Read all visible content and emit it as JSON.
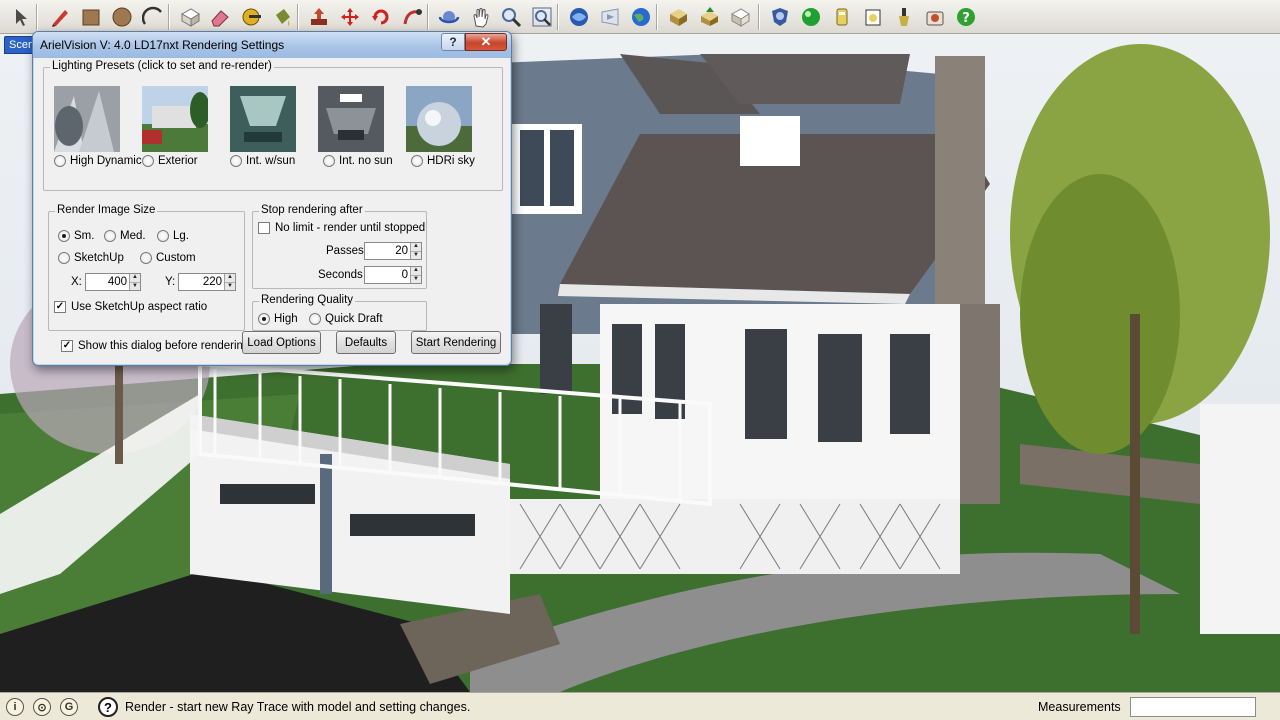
{
  "toolbar": {
    "tools": [
      {
        "name": "select-icon",
        "color": "#4a4a4a"
      },
      {
        "name": "pencil-icon",
        "color": "#c83a2a"
      },
      {
        "name": "rectangle-icon",
        "color": "#a07850"
      },
      {
        "name": "circle-icon",
        "color": "#a07850"
      },
      {
        "name": "arc-icon",
        "color": "#333333"
      },
      {
        "name": "make-component-icon",
        "color": "#d9d4c4"
      },
      {
        "name": "eraser-icon",
        "color": "#e07890"
      },
      {
        "name": "tape-measure-icon",
        "color": "#e0b020"
      },
      {
        "name": "paint-bucket-icon",
        "color": "#7a8a30"
      },
      {
        "name": "push-pull-icon",
        "color": "#c24a2a"
      },
      {
        "name": "move-icon",
        "color": "#d02020"
      },
      {
        "name": "rotate-icon",
        "color": "#d02020"
      },
      {
        "name": "follow-me-icon",
        "color": "#c03030"
      },
      {
        "name": "orbit-icon",
        "color": "#3050b0"
      },
      {
        "name": "pan-icon",
        "color": "#555555"
      },
      {
        "name": "zoom-icon",
        "color": "#4a6aa0"
      },
      {
        "name": "zoom-extents-icon",
        "color": "#4a6aa0"
      },
      {
        "name": "get-models-icon",
        "color": "#2a5ab0"
      },
      {
        "name": "share-model-icon",
        "color": "#8898b0"
      },
      {
        "name": "google-earth-icon",
        "color": "#2a6ad0"
      },
      {
        "name": "get-component-icon",
        "color": "#b09040"
      },
      {
        "name": "share-component-icon",
        "color": "#b09040"
      },
      {
        "name": "extension-icon",
        "color": "#c8c0b0"
      },
      {
        "name": "arielvision-shield-icon",
        "color": "#3a5aa0"
      },
      {
        "name": "render-sphere-icon",
        "color": "#20a030"
      },
      {
        "name": "lamp-icon",
        "color": "#e8d060"
      },
      {
        "name": "light-box-icon",
        "color": "#e8d060"
      },
      {
        "name": "spotlight-icon",
        "color": "#c8b040"
      },
      {
        "name": "camera-icon",
        "color": "#c05030"
      },
      {
        "name": "help-icon",
        "color": "#30a030"
      }
    ]
  },
  "viewport": {
    "scene_tab": "Scen"
  },
  "dialog": {
    "title": "ArielVision V: 4.0 LD17nxt Rendering Settings",
    "help": "?",
    "close": "✕",
    "presets": {
      "legend": "Lighting Presets (click to set and re-render)",
      "items": [
        {
          "label": "High Dynamic",
          "selected": false
        },
        {
          "label": "Exterior",
          "selected": false
        },
        {
          "label": "Int. w/sun",
          "selected": false
        },
        {
          "label": "Int. no sun",
          "selected": false
        },
        {
          "label": "HDRi sky",
          "selected": false
        }
      ]
    },
    "image_size": {
      "legend": "Render Image Size",
      "sm": "Sm.",
      "med": "Med.",
      "lg": "Lg.",
      "sketchup": "SketchUp",
      "custom": "Custom",
      "selected": "sm",
      "x_label": "X:",
      "x_value": "400",
      "y_label": "Y:",
      "y_value": "220",
      "aspect_label": "Use SketchUp aspect ratio",
      "aspect_checked": true
    },
    "stop": {
      "legend": "Stop rendering after",
      "no_limit_label": "No limit - render until stopped",
      "no_limit_checked": false,
      "passes_label": "Passes",
      "passes_value": "20",
      "seconds_label": "Seconds",
      "seconds_value": "0"
    },
    "quality": {
      "legend": "Rendering Quality",
      "high": "High",
      "draft": "Quick Draft",
      "selected": "high"
    },
    "show_dialog_label": "Show this dialog before rendering",
    "show_dialog_checked": true,
    "buttons": {
      "load": "Load Options",
      "defaults": "Defaults",
      "start": "Start Rendering"
    }
  },
  "statusbar": {
    "text": "Render - start new Ray Trace with model and setting changes.",
    "measurements_label": "Measurements",
    "measurements_value": ""
  }
}
